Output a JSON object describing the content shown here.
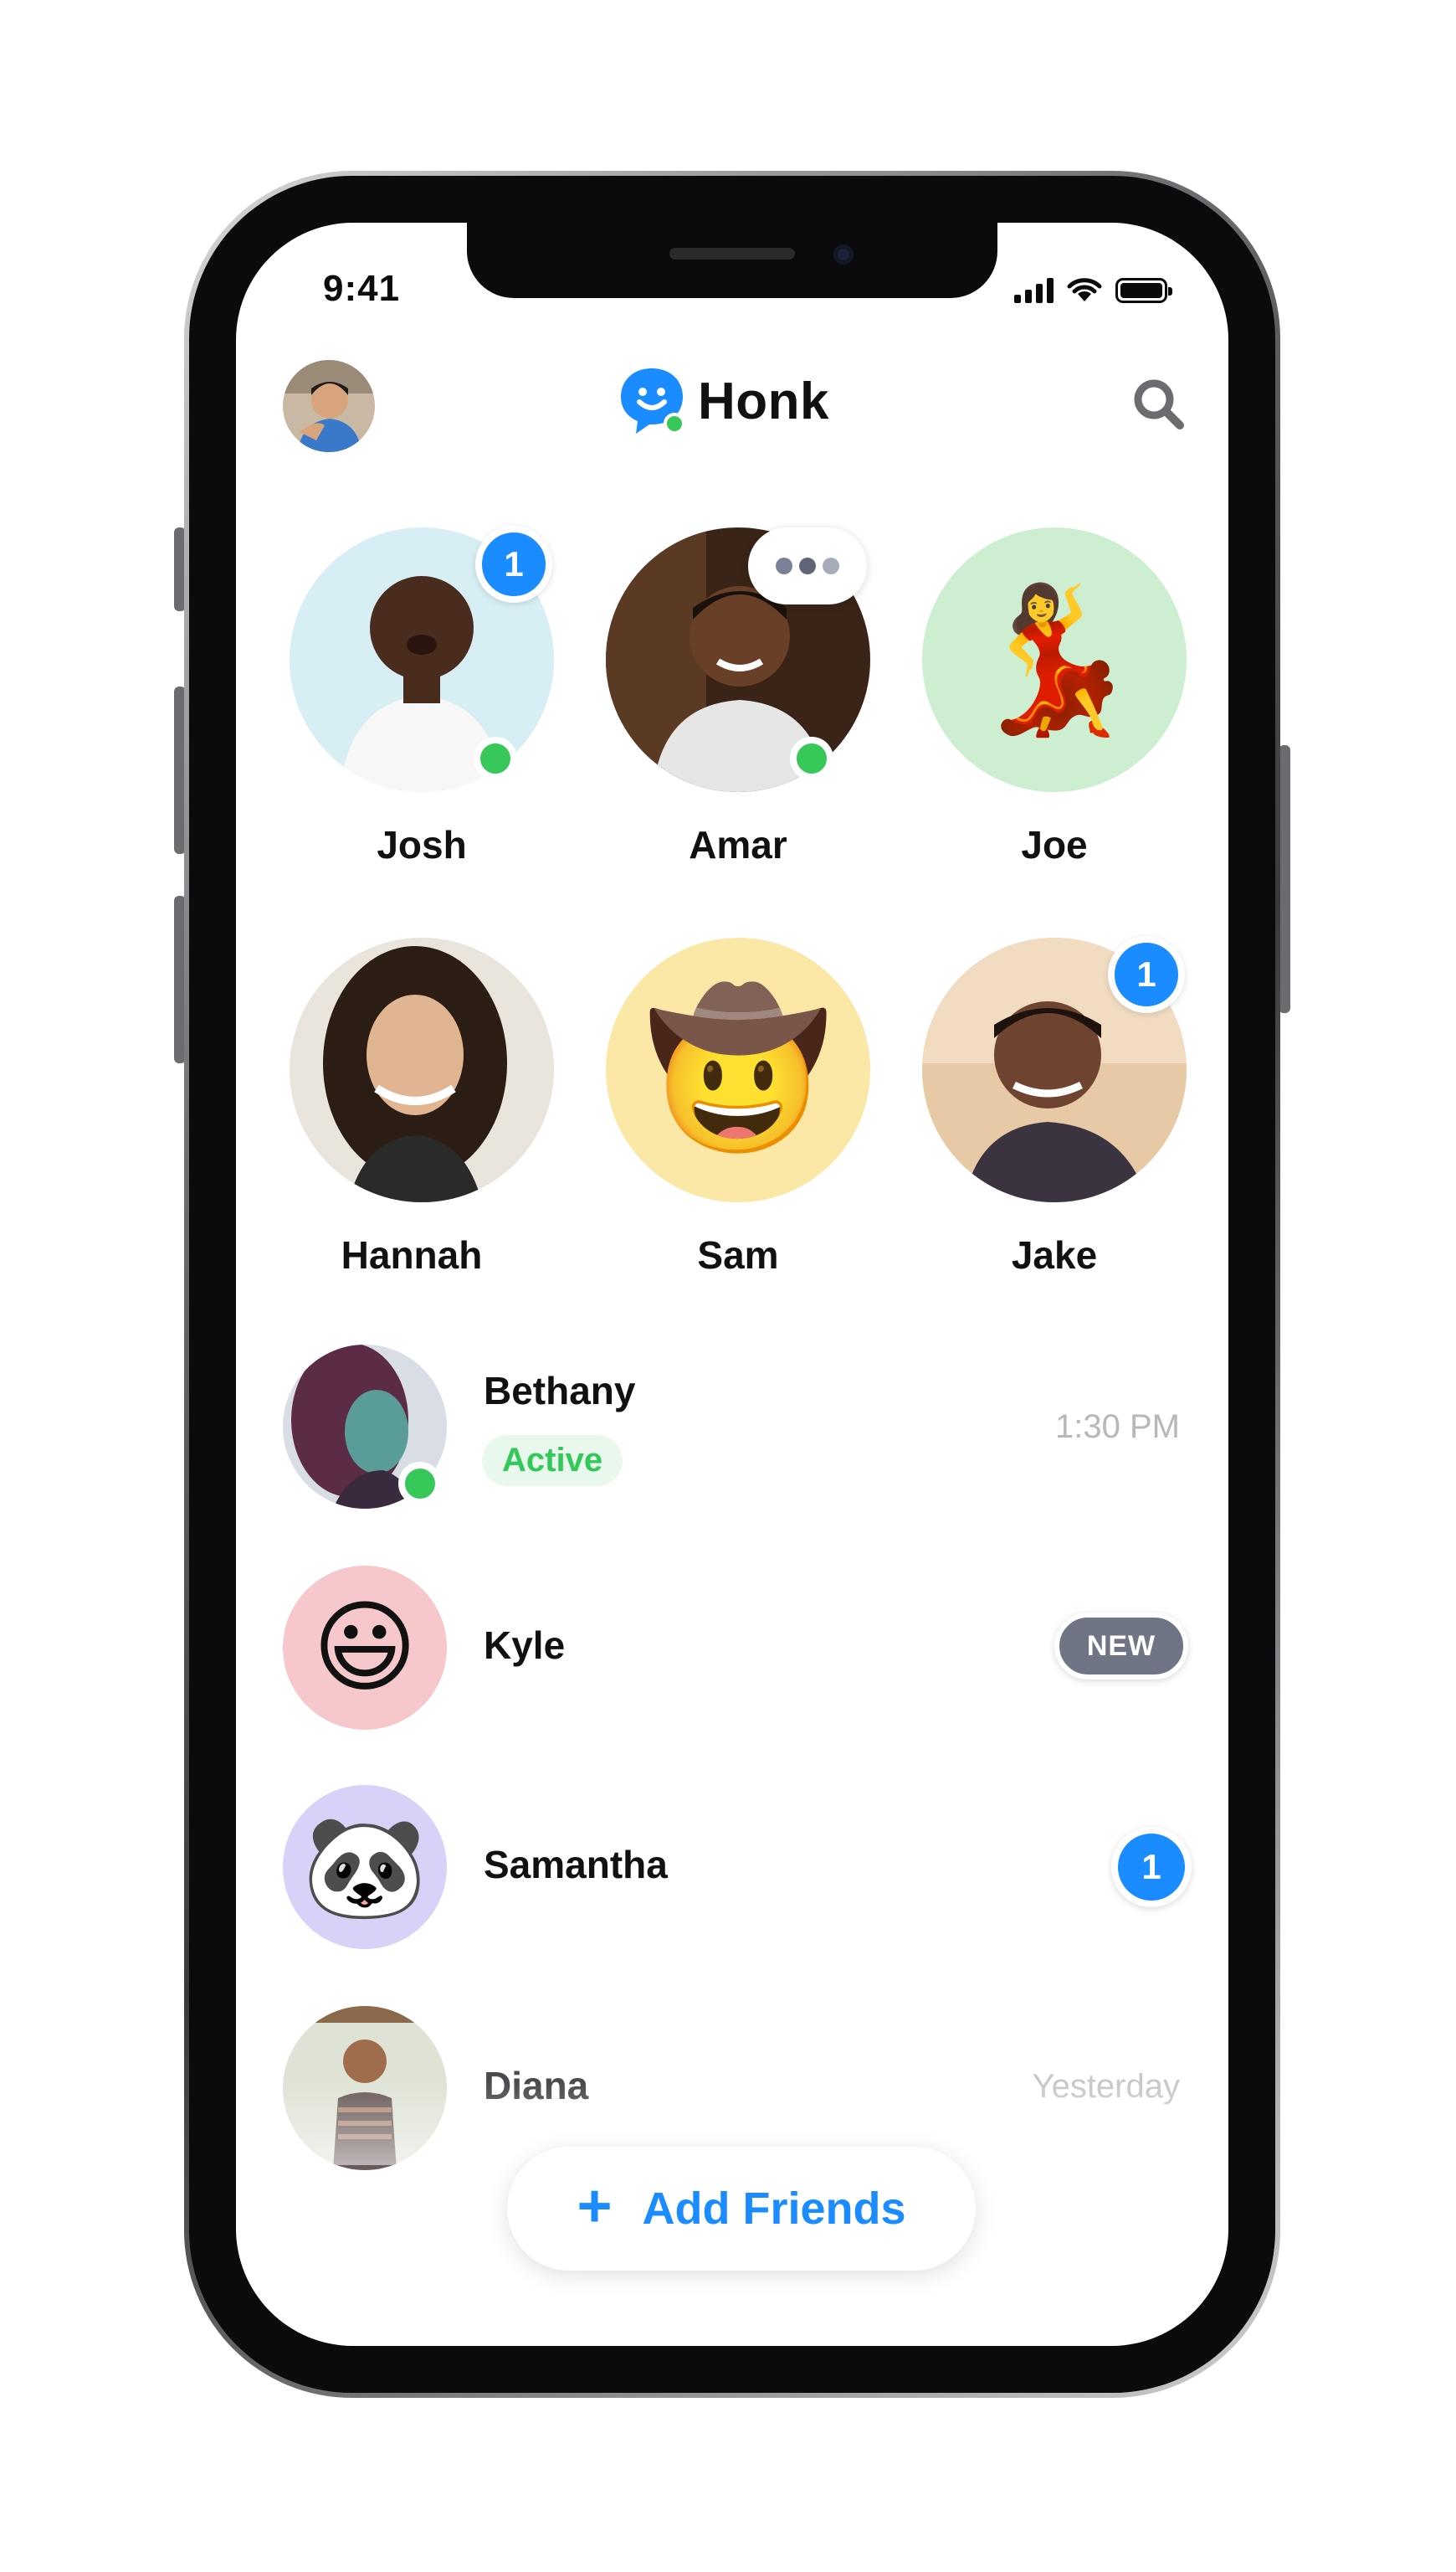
{
  "status_bar": {
    "time": "9:41"
  },
  "header": {
    "app_name": "Honk",
    "brand_color": "#1a8cff",
    "icons": [
      "profile-avatar",
      "honk-logo-icon",
      "search-icon"
    ]
  },
  "favorites": [
    {
      "name": "Josh",
      "avatar": "photo",
      "online": true,
      "unread": "1"
    },
    {
      "name": "Amar",
      "avatar": "photo",
      "online": true,
      "typing": true
    },
    {
      "name": "Joe",
      "avatar": "emoji",
      "emoji": "💃",
      "bg": "#cdeed1"
    },
    {
      "name": "Hannah",
      "avatar": "photo"
    },
    {
      "name": "Sam",
      "avatar": "emoji",
      "emoji": "🤠",
      "bg": "#fbe8a6"
    },
    {
      "name": "Jake",
      "avatar": "photo",
      "unread": "1"
    }
  ],
  "conversations": [
    {
      "name": "Bethany",
      "status": "Active",
      "time": "1:30 PM",
      "online": true
    },
    {
      "name": "Kyle",
      "emoji": "😃",
      "bg": "#f6c8cb",
      "badge": "NEW"
    },
    {
      "name": "Samantha",
      "emoji": "🐼",
      "bg": "#d9d1f7",
      "unread": "1"
    },
    {
      "name": "Diana",
      "time": "Yesterday"
    }
  ],
  "add_friends": {
    "label": "Add Friends",
    "icon": "plus-icon"
  },
  "colors": {
    "online": "#38c85a",
    "badge": "#1a8cff",
    "new_pill": "#6f7585",
    "active_text": "#34c759",
    "active_bg": "#e9f8ec"
  }
}
